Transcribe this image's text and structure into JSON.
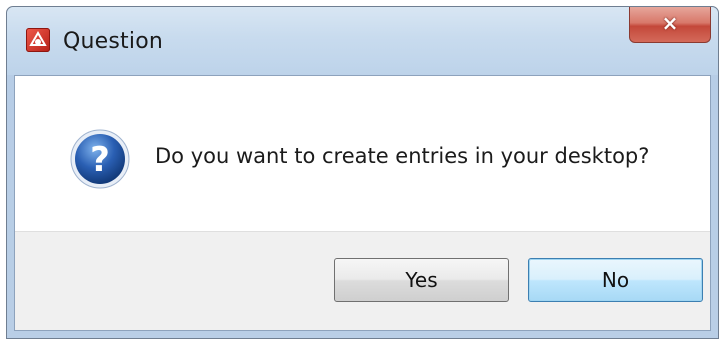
{
  "window": {
    "title": "Question",
    "close_symbol": "×"
  },
  "message": {
    "text": "Do you want to create entries in your desktop?",
    "icon": "question-icon"
  },
  "buttons": {
    "yes_label": "Yes",
    "no_label": "No"
  },
  "colors": {
    "titlebar": "#c8dbee",
    "close_button": "#c4483a",
    "default_button": "#bee6fd",
    "question_icon": "#2a5fb3"
  }
}
